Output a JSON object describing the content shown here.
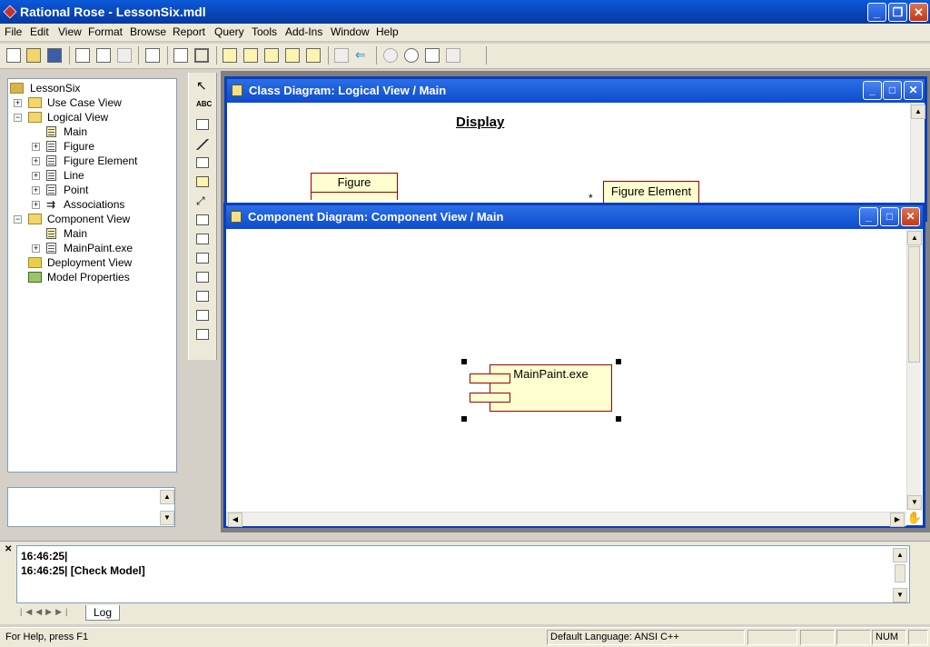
{
  "app": {
    "title": "Rational Rose - LessonSix.mdl"
  },
  "menu": {
    "items": [
      "File",
      "Edit",
      "View",
      "Format",
      "Browse",
      "Report",
      "Query",
      "Tools",
      "Add-Ins",
      "Window",
      "Help"
    ]
  },
  "browser": {
    "root": "LessonSix",
    "items": [
      "Use Case View",
      "Logical View",
      "Main",
      "Figure",
      "Figure Element",
      "Line",
      "Point",
      "Associations",
      "Component View",
      "Main",
      "MainPaint.exe",
      "Deployment View",
      "Model Properties"
    ]
  },
  "class_diagram": {
    "title": "Class Diagram: Logical View / Main",
    "package_label": "Display",
    "classes": [
      "Figure",
      "Figure Element"
    ],
    "multiplicity": "*"
  },
  "component_diagram": {
    "title": "Component Diagram: Component View / Main",
    "component": "MainPaint.exe"
  },
  "log": {
    "lines": [
      "16:46:25|",
      "16:46:25|  [Check Model]"
    ],
    "tab": "Log"
  },
  "status": {
    "help": "For Help, press F1",
    "language": "Default Language: ANSI C++",
    "num": "NUM"
  }
}
